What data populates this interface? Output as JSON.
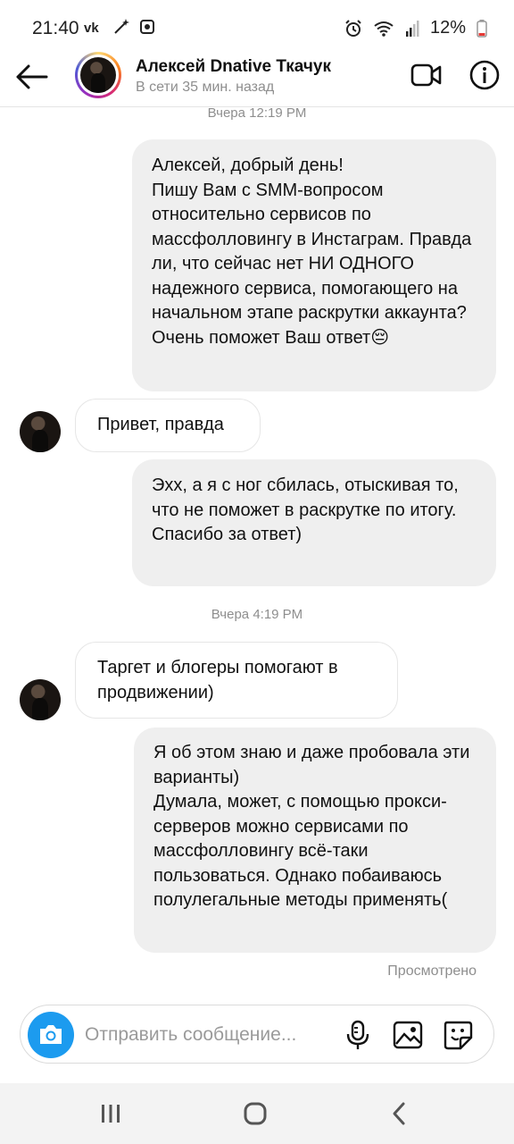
{
  "status_bar": {
    "time": "21:40",
    "battery": "12%",
    "left_icons": [
      "vk-icon",
      "magic-wand-icon",
      "screenshot-icon"
    ],
    "right_icons": [
      "alarm-icon",
      "wifi-icon",
      "signal-icon",
      "battery-icon"
    ]
  },
  "header": {
    "name": "Алексей Dnative Ткачук",
    "status": "В сети 35 мин. назад"
  },
  "chat": {
    "timestamp_1": "Вчера 12:19 PM",
    "msg_1": "Алексей, добрый день!\nПишу Вам с SMM-вопросом относительно сервисов по массфолловингу в Инстаграм. Правда ли, что сейчас нет НИ ОДНОГО надежного сервиса, помогающего на начальном этапе раскрутки аккаунта?\nОчень поможет Ваш ответ😔",
    "msg_2": "Привет, правда",
    "msg_3": "Эхх, а я с ног сбилась, отыскивая то, что не поможет в раскрутке по итогу.\nСпасибо за ответ)",
    "timestamp_2": "Вчера 4:19 PM",
    "msg_4": "Таргет и блогеры помогают в продвижении)",
    "msg_5": "Я об этом знаю и даже пробовала эти варианты)\nДумала, может, с помощью прокси-серверов можно сервисами по массфолловингу всё-таки пользоваться. Однако побаиваюсь полулегальные методы применять(",
    "seen": "Просмотрено"
  },
  "composer": {
    "placeholder": "Отправить сообщение..."
  },
  "colors": {
    "accent": "#1c9bef",
    "outgoing_bubble": "#efefef",
    "muted_text": "#8e8e8e"
  }
}
